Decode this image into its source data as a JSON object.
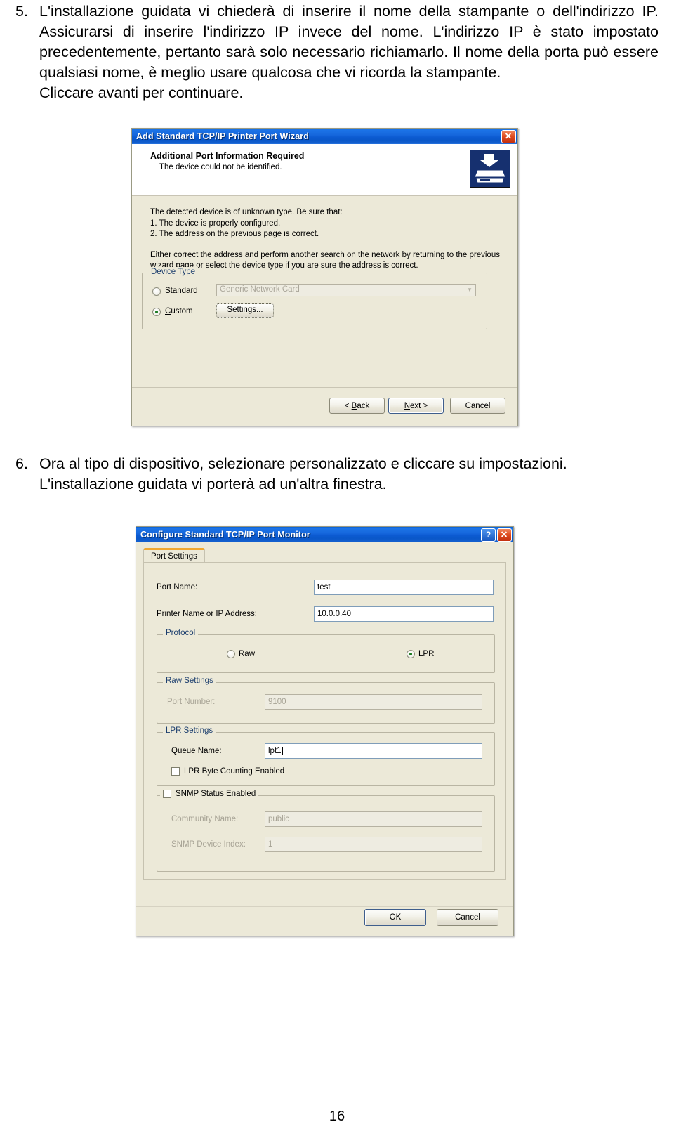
{
  "document": {
    "page_number": "16",
    "paragraphs": [
      {
        "number": "5.",
        "lines": [
          "L'installazione guidata vi chiederà di inserire il nome della stampante o dell'indirizzo IP.  Assicurarsi di inserire l'indirizzo IP invece del nome.  L'indirizzo IP è stato impostato precedentemente, pertanto sarà solo necessario richiamarlo. Il nome della porta può essere qualsiasi nome, è meglio usare qualcosa che vi ricorda la stampante.",
          "Cliccare avanti per continuare."
        ],
        "full_text": "L'installazione guidata vi chiederà di inserire il nome della stampante o dell'indirizzo IP.  Assicurarsi di inserire l'indirizzo IP invece del nome.  L'indirizzo IP è stato impostato precedentemente, pertanto sarà solo necessario richiamarlo. Il nome della porta può essere qualsiasi nome, è meglio usare qualcosa che vi ricorda la stampante.   Cliccare avanti per continuare."
      },
      {
        "number": "6.",
        "line1": "Ora al tipo di dispositivo, selezionare personalizzato e cliccare su impostazioni.",
        "line2": "L'installazione guidata vi porterà ad un'altra finestra."
      }
    ]
  },
  "wizard_dialog": {
    "title": "Add Standard TCP/IP Printer Port Wizard",
    "close_glyph": "✕",
    "header": {
      "heading": "Additional Port Information Required",
      "subheading": "The device could not be identified.",
      "icon": "printer-icon"
    },
    "body": {
      "intro": "The detected device is of unknown type.  Be sure that:",
      "item1": "1. The device is properly configured.",
      "item2": "2.  The address on the previous page is correct.",
      "paragraph": "Either correct the address and perform another search on the network by returning to the previous wizard page or select the device type if you are sure the address is correct."
    },
    "device_type": {
      "legend": "Device Type",
      "standard": {
        "label": "Standard",
        "accel": "S",
        "selected": false,
        "combo_value": "Generic Network Card",
        "combo_arrow": "▼"
      },
      "custom": {
        "label": "Custom",
        "accel": "C",
        "selected": true,
        "settings_button": "Settings..."
      }
    },
    "buttons": {
      "back": "< Back",
      "back_accel": "B",
      "next": "Next >",
      "next_accel": "N",
      "cancel": "Cancel"
    }
  },
  "config_dialog": {
    "title": "Configure Standard TCP/IP Port Monitor",
    "help_glyph": "?",
    "close_glyph": "✕",
    "tab": "Port Settings",
    "fields": {
      "port_name_label": "Port Name:",
      "port_name_value": "test",
      "printer_name_label": "Printer Name or IP Address:",
      "printer_name_value": "10.0.0.40"
    },
    "protocol": {
      "legend": "Protocol",
      "raw_label": "Raw",
      "raw_selected": false,
      "lpr_label": "LPR",
      "lpr_selected": true
    },
    "raw_settings": {
      "legend": "Raw Settings",
      "port_number_label": "Port Number:",
      "port_number_value": "9100",
      "disabled": true
    },
    "lpr_settings": {
      "legend": "LPR Settings",
      "queue_name_label": "Queue Name:",
      "queue_name_value": "lpt1",
      "byte_counting_label": "LPR Byte Counting Enabled",
      "byte_counting_checked": false
    },
    "snmp_settings": {
      "legend": "SNMP Status Enabled",
      "enabled": false,
      "community_name_label": "Community Name:",
      "community_name_value": "public",
      "device_index_label": "SNMP Device Index:",
      "device_index_value": "1"
    },
    "buttons": {
      "ok": "OK",
      "cancel": "Cancel"
    }
  }
}
